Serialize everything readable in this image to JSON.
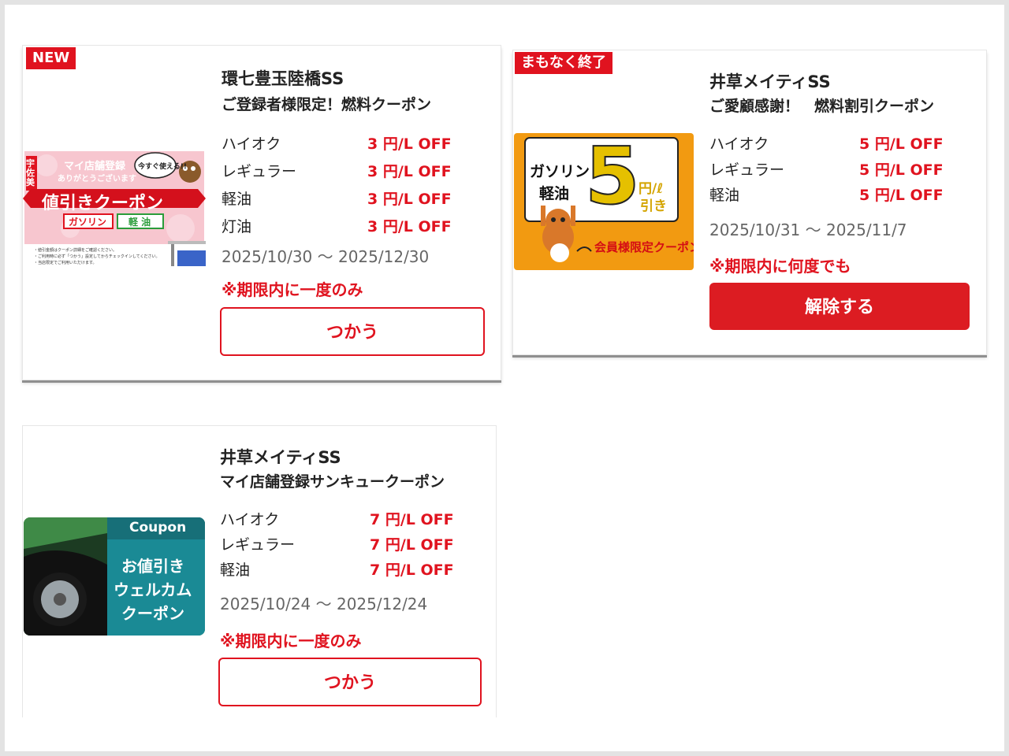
{
  "colors": {
    "accent": "#e0131f",
    "muted": "#666666"
  },
  "cards": [
    {
      "badge": "NEW",
      "store": "環七豊玉陸橋SS",
      "subtitle": "ご登録者様限定！燃料クーポン",
      "rows": [
        {
          "label": "ハイオク",
          "value": "3 円/L OFF"
        },
        {
          "label": "レギュラー",
          "value": "3 円/L OFF"
        },
        {
          "label": "軽油",
          "value": "3 円/L OFF"
        },
        {
          "label": "灯油",
          "value": "3 円/L OFF"
        }
      ],
      "dates": "2025/10/30 〜 2025/12/30",
      "note": "※期限内に一度のみ",
      "button": "つかう",
      "image": {
        "banner_top": "マイ店舗登録",
        "banner_sub": "ありがとうございます",
        "bubble": "今すぐ使える!!",
        "vertical": "宇佐美",
        "main": "値引きクーポン",
        "tag1": "ガソリン",
        "tag2": "軽 油",
        "fine1": "・値引金額はクーポン詳細をご確認ください。",
        "fine2": "・ご利用時に必ず「つかう」設定してからチェックインしてください。",
        "fine3": "・当店限定でご利用いただけます。"
      }
    },
    {
      "badge": "まもなく終了",
      "store": "井草メイティSS",
      "subtitle": "ご愛顧感謝！　燃料割引クーポン",
      "rows": [
        {
          "label": "ハイオク",
          "value": "5 円/L OFF"
        },
        {
          "label": "レギュラー",
          "value": "5 円/L OFF"
        },
        {
          "label": "軽油",
          "value": "5 円/L OFF"
        }
      ],
      "dates": "2025/10/31 〜 2025/11/7",
      "note": "※期限内に何度でも",
      "button": "解除する",
      "image": {
        "line1": "ガソリン",
        "line2": "軽油",
        "big": "5",
        "unit": "円/ℓ",
        "unit2": "引き",
        "footer": "会員様限定クーポン"
      }
    },
    {
      "badge": "",
      "store": "井草メイティSS",
      "subtitle": "マイ店舗登録サンキュークーポン",
      "rows": [
        {
          "label": "ハイオク",
          "value": "7 円/L OFF"
        },
        {
          "label": "レギュラー",
          "value": "7 円/L OFF"
        },
        {
          "label": "軽油",
          "value": "7 円/L OFF"
        }
      ],
      "dates": "2025/10/24 〜 2025/12/24",
      "note": "※期限内に一度のみ",
      "button": "つかう",
      "image": {
        "head": "Coupon",
        "l1": "お値引き",
        "l2": "ウェルカム",
        "l3": "クーポン"
      }
    }
  ]
}
